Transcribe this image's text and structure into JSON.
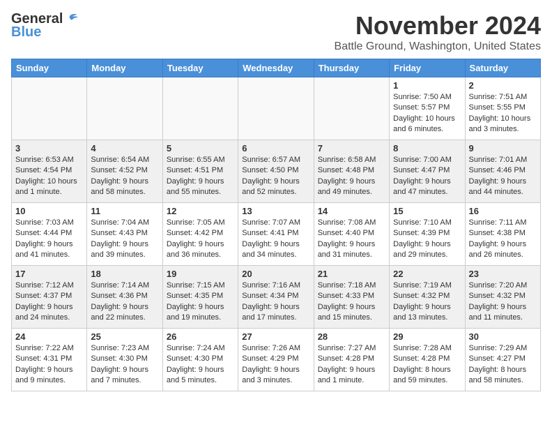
{
  "header": {
    "logo_general": "General",
    "logo_blue": "Blue",
    "month_title": "November 2024",
    "location": "Battle Ground, Washington, United States"
  },
  "weekdays": [
    "Sunday",
    "Monday",
    "Tuesday",
    "Wednesday",
    "Thursday",
    "Friday",
    "Saturday"
  ],
  "weeks": [
    [
      {
        "day": "",
        "info": ""
      },
      {
        "day": "",
        "info": ""
      },
      {
        "day": "",
        "info": ""
      },
      {
        "day": "",
        "info": ""
      },
      {
        "day": "",
        "info": ""
      },
      {
        "day": "1",
        "info": "Sunrise: 7:50 AM\nSunset: 5:57 PM\nDaylight: 10 hours\nand 6 minutes."
      },
      {
        "day": "2",
        "info": "Sunrise: 7:51 AM\nSunset: 5:55 PM\nDaylight: 10 hours\nand 3 minutes."
      }
    ],
    [
      {
        "day": "3",
        "info": "Sunrise: 6:53 AM\nSunset: 4:54 PM\nDaylight: 10 hours\nand 1 minute."
      },
      {
        "day": "4",
        "info": "Sunrise: 6:54 AM\nSunset: 4:52 PM\nDaylight: 9 hours\nand 58 minutes."
      },
      {
        "day": "5",
        "info": "Sunrise: 6:55 AM\nSunset: 4:51 PM\nDaylight: 9 hours\nand 55 minutes."
      },
      {
        "day": "6",
        "info": "Sunrise: 6:57 AM\nSunset: 4:50 PM\nDaylight: 9 hours\nand 52 minutes."
      },
      {
        "day": "7",
        "info": "Sunrise: 6:58 AM\nSunset: 4:48 PM\nDaylight: 9 hours\nand 49 minutes."
      },
      {
        "day": "8",
        "info": "Sunrise: 7:00 AM\nSunset: 4:47 PM\nDaylight: 9 hours\nand 47 minutes."
      },
      {
        "day": "9",
        "info": "Sunrise: 7:01 AM\nSunset: 4:46 PM\nDaylight: 9 hours\nand 44 minutes."
      }
    ],
    [
      {
        "day": "10",
        "info": "Sunrise: 7:03 AM\nSunset: 4:44 PM\nDaylight: 9 hours\nand 41 minutes."
      },
      {
        "day": "11",
        "info": "Sunrise: 7:04 AM\nSunset: 4:43 PM\nDaylight: 9 hours\nand 39 minutes."
      },
      {
        "day": "12",
        "info": "Sunrise: 7:05 AM\nSunset: 4:42 PM\nDaylight: 9 hours\nand 36 minutes."
      },
      {
        "day": "13",
        "info": "Sunrise: 7:07 AM\nSunset: 4:41 PM\nDaylight: 9 hours\nand 34 minutes."
      },
      {
        "day": "14",
        "info": "Sunrise: 7:08 AM\nSunset: 4:40 PM\nDaylight: 9 hours\nand 31 minutes."
      },
      {
        "day": "15",
        "info": "Sunrise: 7:10 AM\nSunset: 4:39 PM\nDaylight: 9 hours\nand 29 minutes."
      },
      {
        "day": "16",
        "info": "Sunrise: 7:11 AM\nSunset: 4:38 PM\nDaylight: 9 hours\nand 26 minutes."
      }
    ],
    [
      {
        "day": "17",
        "info": "Sunrise: 7:12 AM\nSunset: 4:37 PM\nDaylight: 9 hours\nand 24 minutes."
      },
      {
        "day": "18",
        "info": "Sunrise: 7:14 AM\nSunset: 4:36 PM\nDaylight: 9 hours\nand 22 minutes."
      },
      {
        "day": "19",
        "info": "Sunrise: 7:15 AM\nSunset: 4:35 PM\nDaylight: 9 hours\nand 19 minutes."
      },
      {
        "day": "20",
        "info": "Sunrise: 7:16 AM\nSunset: 4:34 PM\nDaylight: 9 hours\nand 17 minutes."
      },
      {
        "day": "21",
        "info": "Sunrise: 7:18 AM\nSunset: 4:33 PM\nDaylight: 9 hours\nand 15 minutes."
      },
      {
        "day": "22",
        "info": "Sunrise: 7:19 AM\nSunset: 4:32 PM\nDaylight: 9 hours\nand 13 minutes."
      },
      {
        "day": "23",
        "info": "Sunrise: 7:20 AM\nSunset: 4:32 PM\nDaylight: 9 hours\nand 11 minutes."
      }
    ],
    [
      {
        "day": "24",
        "info": "Sunrise: 7:22 AM\nSunset: 4:31 PM\nDaylight: 9 hours\nand 9 minutes."
      },
      {
        "day": "25",
        "info": "Sunrise: 7:23 AM\nSunset: 4:30 PM\nDaylight: 9 hours\nand 7 minutes."
      },
      {
        "day": "26",
        "info": "Sunrise: 7:24 AM\nSunset: 4:30 PM\nDaylight: 9 hours\nand 5 minutes."
      },
      {
        "day": "27",
        "info": "Sunrise: 7:26 AM\nSunset: 4:29 PM\nDaylight: 9 hours\nand 3 minutes."
      },
      {
        "day": "28",
        "info": "Sunrise: 7:27 AM\nSunset: 4:28 PM\nDaylight: 9 hours\nand 1 minute."
      },
      {
        "day": "29",
        "info": "Sunrise: 7:28 AM\nSunset: 4:28 PM\nDaylight: 8 hours\nand 59 minutes."
      },
      {
        "day": "30",
        "info": "Sunrise: 7:29 AM\nSunset: 4:27 PM\nDaylight: 8 hours\nand 58 minutes."
      }
    ]
  ]
}
